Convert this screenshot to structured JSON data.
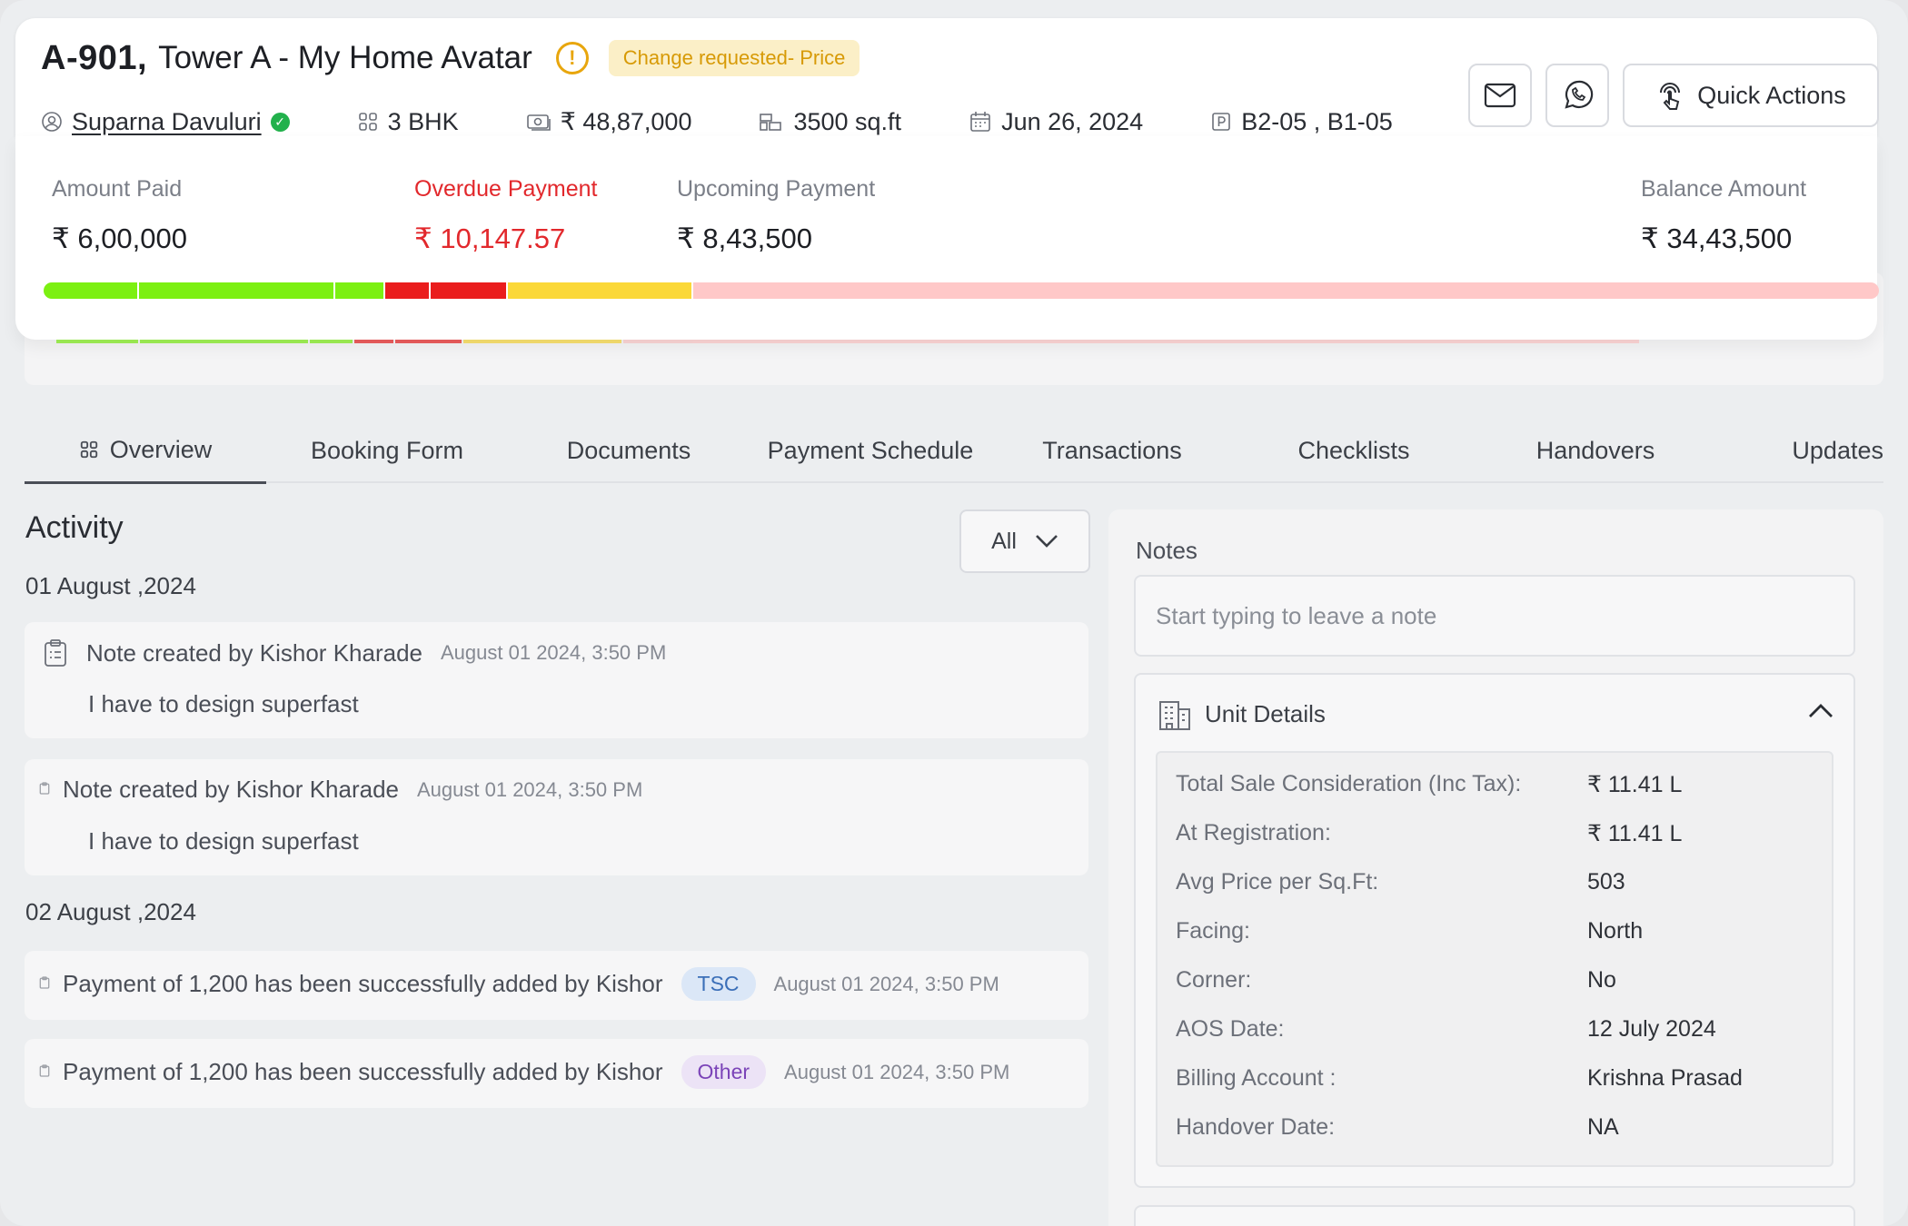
{
  "header": {
    "unit_code": "A-901,",
    "unit_name": "Tower A - My Home Avatar",
    "status_badge": "Change requested- Price",
    "owner": "Suparna Davuluri",
    "config": "3 BHK",
    "price": "₹ 48,87,000",
    "area": "3500 sq.ft",
    "date": "Jun 26, 2024",
    "parking": "B2-05 , B1-05",
    "quick_actions_label": "Quick Actions"
  },
  "payments": {
    "amount_paid_label": "Amount Paid",
    "amount_paid": "₹ 6,00,000",
    "overdue_label": "Overdue Payment",
    "overdue": "₹ 10,147.57",
    "upcoming_label": "Upcoming Payment",
    "upcoming": "₹ 8,43,500",
    "balance_label": "Balance Amount",
    "balance": "₹ 34,43,500",
    "colors": {
      "paid": "#7cf012",
      "overdue": "#ea1d1d",
      "upcoming": "#fbd838",
      "balance": "#ffc8c8"
    },
    "bar_segments": [
      {
        "status": "paid",
        "fraction": 0.052
      },
      {
        "status": "paid",
        "fraction": 0.107
      },
      {
        "status": "paid",
        "fraction": 0.027
      },
      {
        "status": "overdue",
        "fraction": 0.025
      },
      {
        "status": "overdue",
        "fraction": 0.042
      },
      {
        "status": "upcoming",
        "fraction": 0.101
      },
      {
        "status": "balance",
        "fraction": 0.646
      }
    ]
  },
  "tabs": [
    {
      "label": "Overview",
      "active": true
    },
    {
      "label": "Booking Form"
    },
    {
      "label": "Documents"
    },
    {
      "label": "Payment Schedule"
    },
    {
      "label": "Transactions"
    },
    {
      "label": "Checklists"
    },
    {
      "label": "Handovers"
    },
    {
      "label": "Updates"
    }
  ],
  "activity": {
    "title": "Activity",
    "filter_value": "All",
    "groups": [
      {
        "date": "01 August ,2024",
        "items": [
          {
            "title": "Note created by Kishor Kharade",
            "time": "August 01 2024, 3:50 PM",
            "body": "I have to design superfast"
          },
          {
            "title": "Note created by Kishor Kharade",
            "time": "August 01 2024, 3:50 PM",
            "body": "I have to design superfast"
          }
        ]
      },
      {
        "date": "02 August ,2024",
        "items": [
          {
            "title": "Payment of 1,200 has been successfully added by Kishor",
            "tag": "TSC",
            "time": "August 01 2024, 3:50 PM"
          },
          {
            "title": "Payment of 1,200 has been successfully added by Kishor",
            "tag": "Other",
            "time": "August 01 2024, 3:50 PM"
          }
        ]
      }
    ]
  },
  "notes": {
    "label": "Notes",
    "placeholder": "Start typing to leave a note"
  },
  "unit_details": {
    "title": "Unit Details",
    "rows": [
      {
        "key": "Total Sale Consideration (Inc Tax):",
        "value": "₹ 11.41 L"
      },
      {
        "key": "At Registration:",
        "value": "₹ 11.41 L"
      },
      {
        "key": "Avg Price per Sq.Ft:",
        "value": "503"
      },
      {
        "key": "Facing:",
        "value": "North"
      },
      {
        "key": "Corner:",
        "value": "No"
      },
      {
        "key": "AOS Date:",
        "value": "12 July 2024"
      },
      {
        "key": "Billing Account :",
        "value": "Krishna Prasad"
      },
      {
        "key": "Handover Date:",
        "value": "NA"
      }
    ]
  }
}
